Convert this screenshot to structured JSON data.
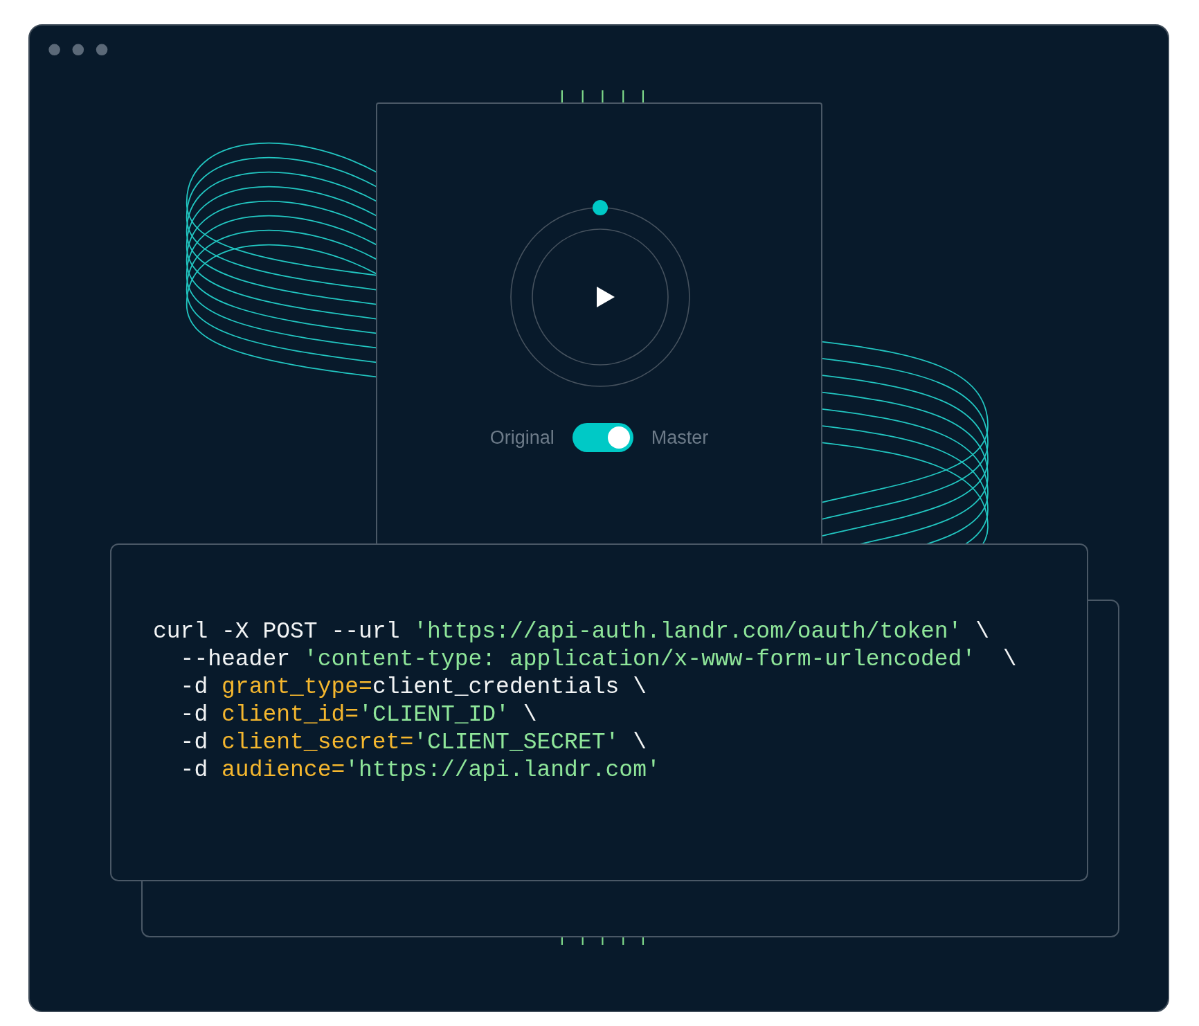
{
  "player": {
    "toggle": {
      "left_label": "Original",
      "right_label": "Master",
      "on": true
    }
  },
  "code": {
    "lines": [
      {
        "segments": [
          {
            "kind": "plain",
            "text": "curl -X POST --url "
          },
          {
            "kind": "string",
            "text": "'https://api-auth.landr.com/oauth/token'"
          },
          {
            "kind": "plain",
            "text": " \\"
          }
        ]
      },
      {
        "segments": [
          {
            "kind": "plain",
            "text": "  --header "
          },
          {
            "kind": "string",
            "text": "'content-type: application/x-www-form-urlencoded'"
          },
          {
            "kind": "plain",
            "text": "  \\"
          }
        ]
      },
      {
        "segments": [
          {
            "kind": "plain",
            "text": "  -d "
          },
          {
            "kind": "key",
            "text": "grant_type="
          },
          {
            "kind": "plain",
            "text": "client_credentials \\"
          }
        ]
      },
      {
        "segments": [
          {
            "kind": "plain",
            "text": "  -d "
          },
          {
            "kind": "key",
            "text": "client_id="
          },
          {
            "kind": "string",
            "text": "'CLIENT_ID'"
          },
          {
            "kind": "plain",
            "text": " \\"
          }
        ]
      },
      {
        "segments": [
          {
            "kind": "plain",
            "text": "  -d "
          },
          {
            "kind": "key",
            "text": "client_secret="
          },
          {
            "kind": "string",
            "text": "'CLIENT_SECRET'"
          },
          {
            "kind": "plain",
            "text": " \\"
          }
        ]
      },
      {
        "segments": [
          {
            "kind": "plain",
            "text": "  -d "
          },
          {
            "kind": "key",
            "text": "audience="
          },
          {
            "kind": "string",
            "text": "'https://api.landr.com'"
          }
        ]
      }
    ]
  }
}
